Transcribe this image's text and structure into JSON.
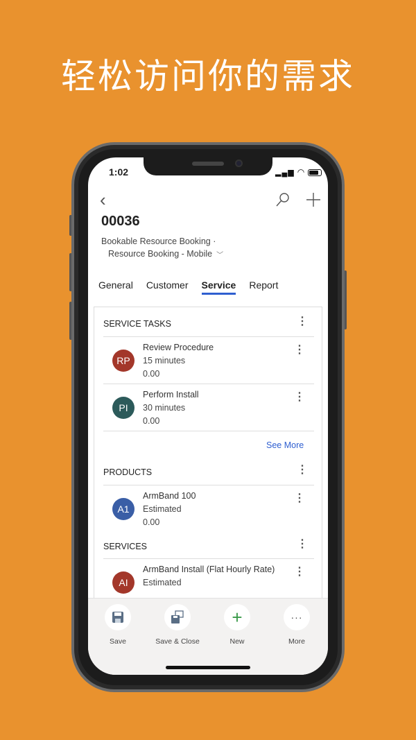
{
  "headline": "轻松访问你的需求",
  "status": {
    "time": "1:02"
  },
  "record": {
    "id": "00036",
    "entity": "Bookable Resource Booking ·",
    "form": "Resource Booking - Mobile"
  },
  "tabs": [
    {
      "label": "General"
    },
    {
      "label": "Customer"
    },
    {
      "label": "Service",
      "active": true
    },
    {
      "label": "Report"
    }
  ],
  "accent": "#2F5FD0",
  "service_tasks": {
    "title": "SERVICE TASKS",
    "items": [
      {
        "initials": "RP",
        "color": "#A3372A",
        "name": "Review Procedure",
        "duration": "15 minutes",
        "value": "0.00"
      },
      {
        "initials": "PI",
        "color": "#2C5A5A",
        "name": "Perform Install",
        "duration": "30 minutes",
        "value": "0.00"
      }
    ],
    "see_more": "See More"
  },
  "products": {
    "title": "PRODUCTS",
    "items": [
      {
        "initials": "A1",
        "color": "#3A5EA6",
        "name": "ArmBand 100",
        "status": "Estimated",
        "value": "0.00"
      }
    ]
  },
  "services": {
    "title": "SERVICES",
    "items": [
      {
        "initials": "AI",
        "color": "#A3372A",
        "name": "ArmBand Install (Flat Hourly Rate)",
        "status": "Estimated"
      }
    ]
  },
  "commands": [
    {
      "label": "Save",
      "icon": "save-icon"
    },
    {
      "label": "Save & Close",
      "icon": "save-close-icon"
    },
    {
      "label": "New",
      "icon": "plus-icon"
    },
    {
      "label": "More",
      "icon": "more-icon"
    }
  ]
}
